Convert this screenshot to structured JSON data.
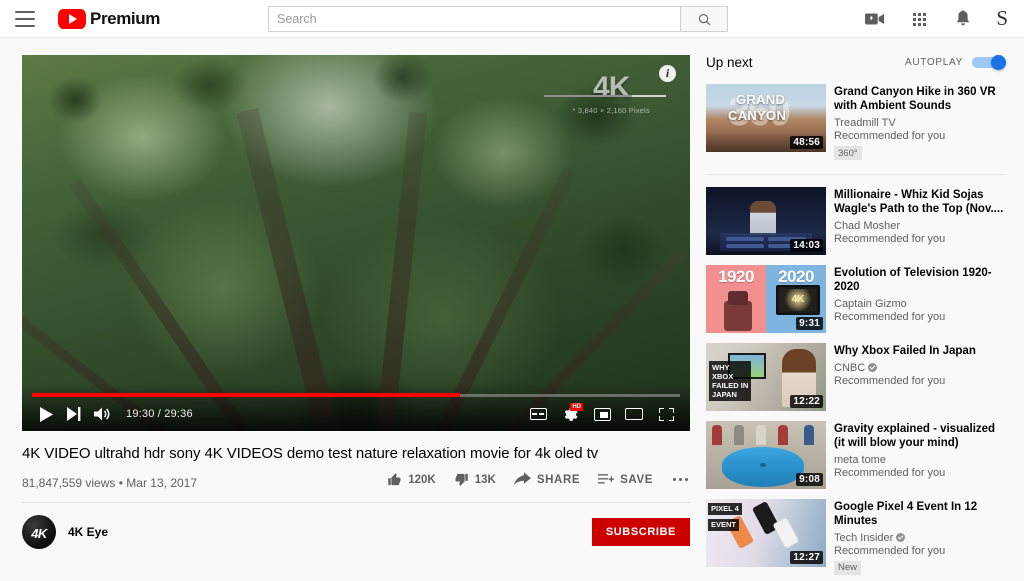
{
  "masthead": {
    "menu_icon": "hamburger-menu-icon",
    "logo_text": "Premium",
    "logo_icon": "youtube-play-icon",
    "search": {
      "value": "",
      "placeholder": "Search",
      "button_icon": "search-icon"
    },
    "icons": [
      {
        "name": "create-video-icon",
        "glyph": "video-camera"
      },
      {
        "name": "apps-grid-icon",
        "glyph": "grid"
      },
      {
        "name": "notifications-icon",
        "glyph": "bell"
      }
    ],
    "avatar_letter": "S"
  },
  "player": {
    "watermark": {
      "main": "4K",
      "sub": "* 3,840 × 2,160 Pixels"
    },
    "info_button": "i",
    "controls": {
      "play_icon": "play-icon",
      "next_icon": "next-video-icon",
      "volume_icon": "volume-icon",
      "time_display": "19:30 / 29:36",
      "current_time": "19:30",
      "duration": "29:36",
      "progress_percent": 66,
      "captions_label": "CC",
      "hd_badge": "HD",
      "settings_icon": "gear-icon",
      "miniplayer_icon": "miniplayer-icon",
      "theater_icon": "theater-mode-icon",
      "fullscreen_icon": "fullscreen-icon"
    }
  },
  "video": {
    "title": "4K VIDEO ultrahd hdr sony 4K VIDEOS demo test nature relaxation movie for 4k oled tv",
    "views": "81,847,559 views",
    "separator": "•",
    "date": "Mar 13, 2017",
    "actions": {
      "like_count": "120K",
      "like_icon": "thumbs-up-icon",
      "dislike_count": "13K",
      "dislike_icon": "thumbs-down-icon",
      "share_label": "SHARE",
      "share_icon": "share-icon",
      "save_label": "SAVE",
      "save_icon": "save-to-playlist-icon",
      "more_icon": "more-actions-icon"
    },
    "channel": {
      "name": "4K Eye",
      "avatar_text": "4K",
      "subscribe_label": "SUBSCRIBE",
      "subscribe_color": "#cc0000"
    }
  },
  "sidebar": {
    "heading": "Up next",
    "autoplay_label": "AUTOPLAY",
    "autoplay_on": true,
    "autoplay_color": "#1a73e8",
    "items": [
      {
        "title": "Grand Canyon Hike in 360 VR with Ambient Sounds",
        "channel": "Treadmill TV",
        "verified": false,
        "meta": "Recommended for you",
        "badge": "360°",
        "duration": "48:56",
        "thumb": "canyon"
      },
      {
        "title": "Millionaire - Whiz Kid Sojas Wagle's Path to the Top (Nov....",
        "channel": "Chad Mosher",
        "verified": false,
        "meta": "Recommended for you",
        "badge": "",
        "duration": "14:03",
        "thumb": "millionaire"
      },
      {
        "title": "Evolution of Television 1920-2020",
        "channel": "Captain Gizmo",
        "verified": false,
        "meta": "Recommended for you",
        "badge": "",
        "duration": "9:31",
        "thumb": "television"
      },
      {
        "title": "Why Xbox Failed In Japan",
        "channel": "CNBC",
        "verified": true,
        "meta": "Recommended for you",
        "badge": "",
        "duration": "12:22",
        "thumb": "xbox"
      },
      {
        "title": "Gravity explained - visualized (it will blow your mind)",
        "channel": "meta tome",
        "verified": false,
        "meta": "Recommended for you",
        "badge": "",
        "duration": "9:08",
        "thumb": "gravity"
      },
      {
        "title": "Google Pixel 4 Event In 12 Minutes",
        "channel": "Tech Insider",
        "verified": true,
        "meta": "Recommended for you",
        "badge": "New",
        "duration": "12:27",
        "thumb": "pixel"
      }
    ]
  }
}
